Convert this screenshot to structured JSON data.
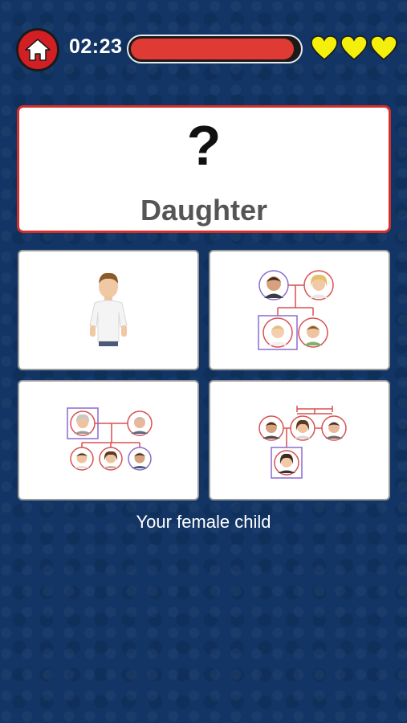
{
  "hud": {
    "timer": "02:23",
    "progress_fraction": 0.97,
    "lives": 3,
    "home_icon": "home-icon",
    "heart_color": "#f4f00b"
  },
  "question": {
    "symbol": "?",
    "word": "Daughter"
  },
  "options": [
    {
      "name": "option-boy-photo",
      "icon": "boy-portrait"
    },
    {
      "name": "option-family-tree-parents-children",
      "icon": "family-tree"
    },
    {
      "name": "option-family-tree-grandparents",
      "icon": "family-tree"
    },
    {
      "name": "option-family-tree-siblings-child",
      "icon": "family-tree"
    }
  ],
  "hint": "Your female child",
  "colors": {
    "background": "#123566",
    "accent_red": "#d42f2a",
    "highlight_purple": "#8a6bd0"
  }
}
